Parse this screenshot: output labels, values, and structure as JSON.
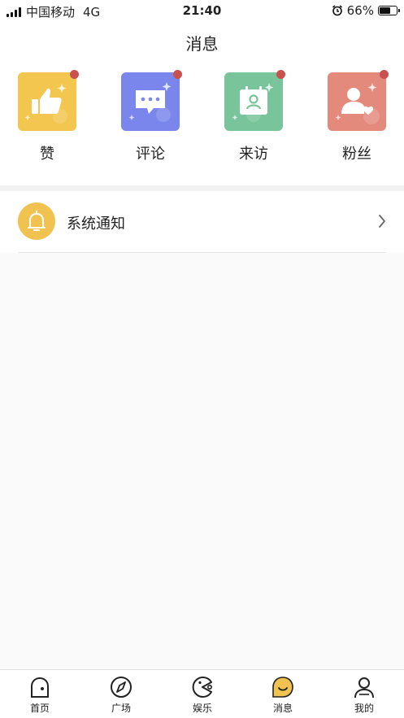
{
  "status_bar": {
    "carrier": "中国移动",
    "network": "4G",
    "time": "21:40",
    "battery": "66%",
    "battery_level": 0.66
  },
  "header": {
    "title": "消息"
  },
  "categories": [
    {
      "label": "赞",
      "icon": "thumbs-up-icon",
      "color": "#f3c64f"
    },
    {
      "label": "评论",
      "icon": "comment-icon",
      "color": "#7b86ec"
    },
    {
      "label": "来访",
      "icon": "visitor-icon",
      "color": "#79c49a"
    },
    {
      "label": "粉丝",
      "icon": "fans-icon",
      "color": "#e48a7d"
    }
  ],
  "notification": {
    "label": "系统通知",
    "icon": "bell-icon",
    "color": "#f0c24f"
  },
  "tabbar": [
    {
      "label": "首页",
      "icon": "home-icon"
    },
    {
      "label": "广场",
      "icon": "compass-icon"
    },
    {
      "label": "娱乐",
      "icon": "pacman-icon"
    },
    {
      "label": "消息",
      "icon": "message-smile-icon",
      "active": true
    },
    {
      "label": "我的",
      "icon": "profile-icon"
    }
  ],
  "colors": {
    "badge_dot": "#c9524f",
    "accent": "#f0c24f"
  }
}
